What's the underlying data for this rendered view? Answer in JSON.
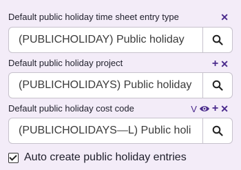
{
  "fields": [
    {
      "label": "Default public holiday time sheet entry type",
      "value": "(PUBLICHOLIDAY) Public holiday",
      "actions": [
        "x-icon"
      ]
    },
    {
      "label": "Default public holiday project",
      "value": "(PUBLICHOLIDAYS) Public holiday",
      "actions": [
        "plus-icon",
        "x-icon"
      ]
    },
    {
      "label": "Default public holiday cost code",
      "value": "(PUBLICHOLIDAYS—L) Public holi",
      "actions": [
        "v-icon",
        "eye-icon",
        "plus-icon",
        "x-icon"
      ],
      "v_label": "V"
    }
  ],
  "checkbox": {
    "label": "Auto create public holiday entries",
    "checked": true
  },
  "colors": {
    "background": "#f3ecf8",
    "accent": "#4a2a8c",
    "border": "#c6c1cc"
  }
}
